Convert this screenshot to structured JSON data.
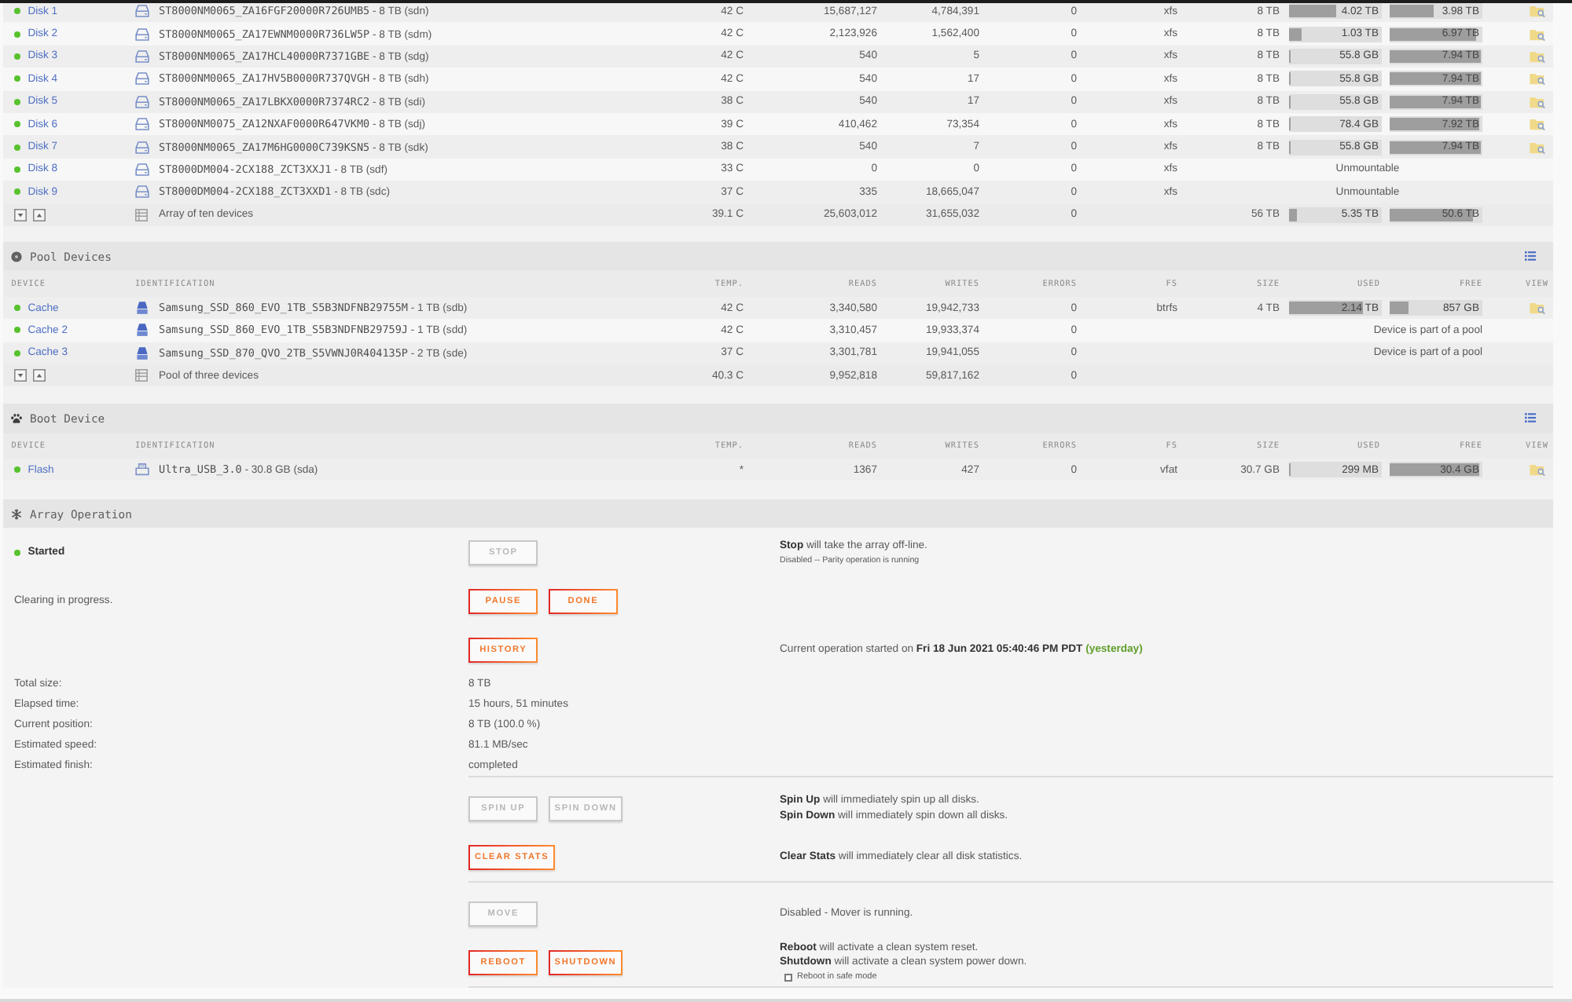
{
  "array_devices": {
    "rows": [
      {
        "device": "Disk 1",
        "online": true,
        "identification": "ST8000NM0065_ZA16FGF20000R726UMB5",
        "detail": "- 8 TB (sdn)",
        "temp": "42 C",
        "reads": "15,687,127",
        "writes": "4,784,391",
        "errors": "0",
        "fs": "xfs",
        "size": "8 TB",
        "used": {
          "text": "4.02 TB",
          "level": 0.51
        },
        "free": {
          "text": "3.98 TB",
          "level": 0.47
        }
      },
      {
        "device": "Disk 2",
        "online": true,
        "identification": "ST8000NM0065_ZA17EWNM0000R736LW5P",
        "detail": "- 8 TB (sdm)",
        "temp": "42 C",
        "reads": "2,123,926",
        "writes": "1,562,400",
        "errors": "0",
        "fs": "xfs",
        "size": "8 TB",
        "used": {
          "text": "1.03 TB",
          "level": 0.14
        },
        "free": {
          "text": "6.97 TB",
          "level": 0.94
        }
      },
      {
        "device": "Disk 3",
        "online": true,
        "identification": "ST8000NM0065_ZA17HCL40000R7371GBE",
        "detail": "- 8 TB (sdg)",
        "temp": "42 C",
        "reads": "540",
        "writes": "5",
        "errors": "0",
        "fs": "xfs",
        "size": "8 TB",
        "used": {
          "text": "55.8 GB",
          "level": 0.01
        },
        "free": {
          "text": "7.94 TB",
          "level": 0.98
        }
      },
      {
        "device": "Disk 4",
        "online": true,
        "identification": "ST8000NM0065_ZA17HV5B0000R737QVGH",
        "detail": "- 8 TB (sdh)",
        "temp": "42 C",
        "reads": "540",
        "writes": "17",
        "errors": "0",
        "fs": "xfs",
        "size": "8 TB",
        "used": {
          "text": "55.8 GB",
          "level": 0.01
        },
        "free": {
          "text": "7.94 TB",
          "level": 0.98
        }
      },
      {
        "device": "Disk 5",
        "online": true,
        "identification": "ST8000NM0065_ZA17LBKX0000R7374RC2",
        "detail": "- 8 TB (sdi)",
        "temp": "38 C",
        "reads": "540",
        "writes": "17",
        "errors": "0",
        "fs": "xfs",
        "size": "8 TB",
        "used": {
          "text": "55.8 GB",
          "level": 0.01
        },
        "free": {
          "text": "7.94 TB",
          "level": 0.98
        }
      },
      {
        "device": "Disk 6",
        "online": true,
        "identification": "ST8000NM0075_ZA12NXAF0000R647VKM0",
        "detail": "- 8 TB (sdj)",
        "temp": "39 C",
        "reads": "410,462",
        "writes": "73,354",
        "errors": "0",
        "fs": "xfs",
        "size": "8 TB",
        "used": {
          "text": "78.4 GB",
          "level": 0.01
        },
        "free": {
          "text": "7.92 TB",
          "level": 0.96
        }
      },
      {
        "device": "Disk 7",
        "online": true,
        "identification": "ST8000NM0065_ZA17M6HG0000C739KSN5",
        "detail": "- 8 TB (sdk)",
        "temp": "38 C",
        "reads": "540",
        "writes": "7",
        "errors": "0",
        "fs": "xfs",
        "size": "8 TB",
        "used": {
          "text": "55.8 GB",
          "level": 0.01
        },
        "free": {
          "text": "7.94 TB",
          "level": 0.98
        }
      },
      {
        "device": "Disk 8",
        "online": true,
        "identification": "ST8000DM004-2CX188_ZCT3XXJ1",
        "detail": "- 8 TB (sdf)",
        "temp": "33 C",
        "reads": "0",
        "writes": "0",
        "errors": "0",
        "fs": "xfs",
        "note": "Unmountable"
      },
      {
        "device": "Disk 9",
        "online": true,
        "identification": "ST8000DM004-2CX188_ZCT3XXD1",
        "detail": "- 8 TB (sdc)",
        "temp": "37 C",
        "reads": "335",
        "writes": "18,665,047",
        "errors": "0",
        "fs": "xfs",
        "note": "Unmountable"
      }
    ],
    "summary": {
      "label": "Array of ten devices",
      "temp": "39.1 C",
      "reads": "25,603,012",
      "writes": "31,655,032",
      "errors": "0",
      "size": "56 TB",
      "used": {
        "text": "5.35 TB",
        "level": 0.09
      },
      "free": {
        "text": "50.6 TB",
        "level": 0.9
      }
    }
  },
  "pool_devices": {
    "title": "Pool Devices",
    "columns": [
      "DEVICE",
      "IDENTIFICATION",
      "TEMP.",
      "READS",
      "WRITES",
      "ERRORS",
      "FS",
      "SIZE",
      "USED",
      "FREE",
      "VIEW"
    ],
    "rows": [
      {
        "device": "Cache",
        "online": true,
        "identification": "Samsung_SSD_860_EVO_1TB_S5B3NDFNB29755M",
        "detail": "- 1 TB (sdb)",
        "temp": "42 C",
        "reads": "3,340,580",
        "writes": "19,942,733",
        "errors": "0",
        "fs": "btrfs",
        "size": "4 TB",
        "used": {
          "text": "2.14 TB",
          "level": 0.79
        },
        "free": {
          "text": "857 GB",
          "level": 0.21
        }
      },
      {
        "device": "Cache 2",
        "online": true,
        "identification": "Samsung_SSD_860_EVO_1TB_S5B3NDFNB29759J",
        "detail": "- 1 TB (sdd)",
        "temp": "42 C",
        "reads": "3,310,457",
        "writes": "19,933,374",
        "errors": "0",
        "note": "Device is part of a pool"
      },
      {
        "device": "Cache 3",
        "online": true,
        "identification": "Samsung_SSD_870_QVO_2TB_S5VWNJ0R404135P",
        "detail": "- 2 TB (sde)",
        "temp": "37 C",
        "reads": "3,301,781",
        "writes": "19,941,055",
        "errors": "0",
        "note": "Device is part of a pool"
      }
    ],
    "summary": {
      "label": "Pool of three devices",
      "temp": "40.3 C",
      "reads": "9,952,818",
      "writes": "59,817,162",
      "errors": "0"
    }
  },
  "boot_device": {
    "title": "Boot Device",
    "columns": [
      "DEVICE",
      "IDENTIFICATION",
      "TEMP.",
      "READS",
      "WRITES",
      "ERRORS",
      "FS",
      "SIZE",
      "USED",
      "FREE",
      "VIEW"
    ],
    "rows": [
      {
        "device": "Flash",
        "online": true,
        "identification": "Ultra_USB_3.0",
        "detail": "- 30.8 GB (sda)",
        "temp": "*",
        "reads": "1367",
        "writes": "427",
        "errors": "0",
        "fs": "vfat",
        "size": "30.7 GB",
        "used": {
          "text": "299 MB",
          "level": 0.01
        },
        "free": {
          "text": "30.4 GB",
          "level": 0.97
        }
      }
    ]
  },
  "array_operation": {
    "title": "Array Operation",
    "groups": [
      {
        "rows": [
          {
            "status": {
              "label": "Started",
              "running": true
            },
            "buttons": [
              {
                "label": "STOP",
                "disabled": true
              }
            ],
            "lines": [
              "**Stop** will take the array off-line."
            ],
            "note": "Disabled -- Parity operation is running"
          },
          {
            "label": "Clearing in progress.",
            "buttons": [
              {
                "label": "PAUSE",
                "disabled": false
              },
              {
                "label": "DONE",
                "disabled": false
              }
            ]
          },
          {
            "buttons": [
              {
                "label": "HISTORY",
                "disabled": false
              }
            ],
            "lines": [
              "Current operation started on **Fri 18 Jun 2021 05:40:46 PM PDT**"
            ],
            "relative": "(yesterday)"
          }
        ],
        "details": [
          {
            "label": "Total size:",
            "value": "8 TB"
          },
          {
            "label": "Elapsed time:",
            "value": "15 hours, 51 minutes"
          },
          {
            "label": "Current position:",
            "value": "8 TB (100.0 %)"
          },
          {
            "label": "Estimated speed:",
            "value": "81.1 MB/sec"
          },
          {
            "label": "Estimated finish:",
            "value": "completed"
          }
        ]
      },
      {
        "rows": [
          {
            "buttons": [
              {
                "label": "SPIN UP",
                "disabled": true
              },
              {
                "label": "SPIN DOWN",
                "disabled": true
              }
            ],
            "lines": [
              "**Spin Up** will immediately spin up all disks.",
              "**Spin Down** will immediately spin down all disks."
            ]
          },
          {
            "buttons": [
              {
                "label": "CLEAR STATS",
                "disabled": false
              }
            ],
            "lines": [
              "**Clear Stats** will immediately clear all disk statistics."
            ]
          }
        ]
      },
      {
        "rows": [
          {
            "buttons": [
              {
                "label": "MOVE",
                "disabled": true
              }
            ],
            "lines": [
              "Disabled - Mover is running."
            ]
          },
          {
            "buttons": [
              {
                "label": "REBOOT",
                "disabled": false
              },
              {
                "label": "SHUTDOWN",
                "disabled": false
              }
            ],
            "lines": [
              "**Reboot** will activate a clean system reset.",
              "**Shutdown** will activate a clean system power down."
            ],
            "checkbox": {
              "label": "Reboot in safe mode",
              "checked": false
            }
          }
        ]
      }
    ]
  }
}
